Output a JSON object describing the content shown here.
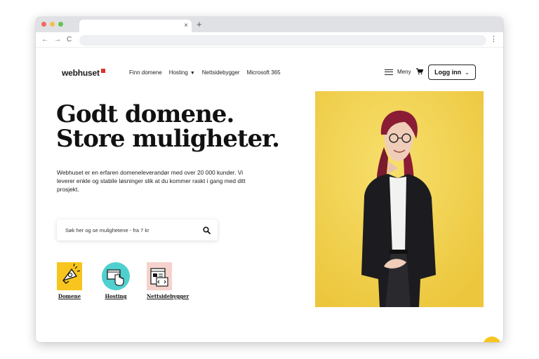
{
  "browser": {
    "tab_close": "×",
    "new_tab": "+",
    "back": "←",
    "forward": "→",
    "reload": "C",
    "menu": "⋮"
  },
  "header": {
    "logo": "webhuset",
    "nav": [
      {
        "label": "Finn domene"
      },
      {
        "label": "Hosting",
        "dropdown": true
      },
      {
        "label": "Nettsidebygger"
      },
      {
        "label": "Microsoft 365"
      }
    ],
    "menu_label": "Meny",
    "login_label": "Logg inn"
  },
  "hero": {
    "headline_line1": "Godt domene.",
    "headline_line2": "Store muligheter.",
    "intro": "Webhuset er en erfaren domeneleverandør med over 20 000 kunder. Vi leverer enkle og stabile løsninger slik at du kommer raskt i gang med ditt prosjekt."
  },
  "search": {
    "placeholder": "Søk her og se mulighetene - fra 7 kr"
  },
  "categories": [
    {
      "label": "Domene",
      "color": "#f7c51d"
    },
    {
      "label": "Hosting",
      "color": "#4fd0cf"
    },
    {
      "label": "Nettsidebygger",
      "color": "#f6d2cd"
    }
  ],
  "colors": {
    "accent": "#f7c51d",
    "hero_bg": "#f2d24b",
    "logo_mark": "#e0302a"
  }
}
